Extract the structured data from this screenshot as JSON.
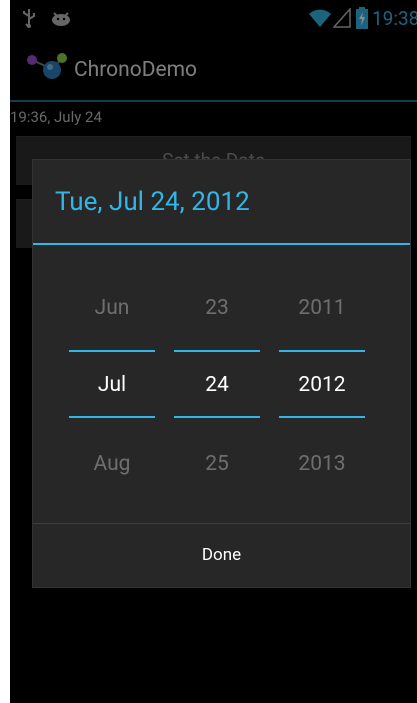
{
  "status_bar": {
    "time": "19:38",
    "icons": [
      "usb-icon",
      "android-icon",
      "wifi-icon",
      "signal-icon",
      "battery-charging-icon"
    ],
    "accent_color": "#33b5e5"
  },
  "action_bar": {
    "title": "ChronoDemo",
    "icon": "app-icon"
  },
  "content": {
    "time_text": "19:36, July 24",
    "set_date_button_label": "Set the Date"
  },
  "dialog": {
    "title": "Tue, Jul 24, 2012",
    "month_picker": {
      "prev": "Jun",
      "current": "Jul",
      "next": "Aug"
    },
    "day_picker": {
      "prev": "23",
      "current": "24",
      "next": "25"
    },
    "year_picker": {
      "prev": "2011",
      "current": "2012",
      "next": "2013"
    },
    "done_label": "Done"
  }
}
